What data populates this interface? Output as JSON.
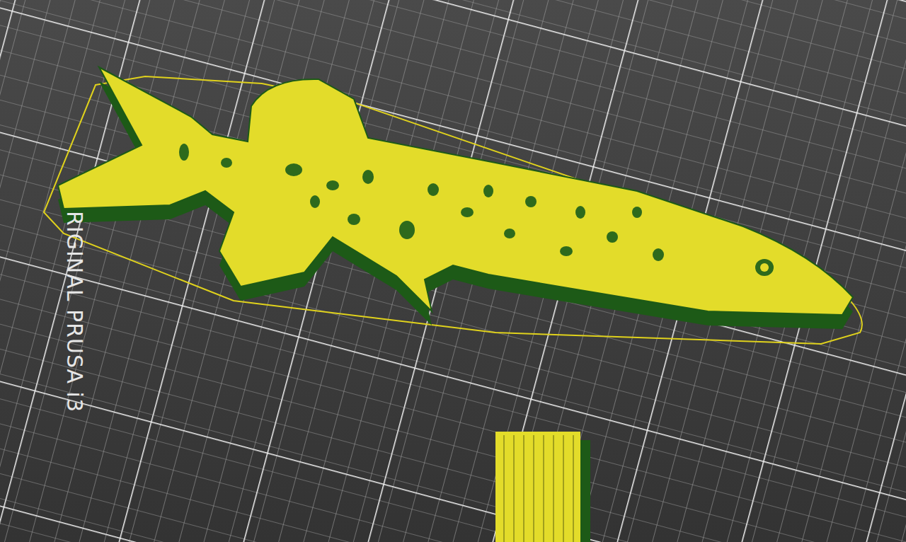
{
  "bed": {
    "label": "RIGINAL PRUSA i3"
  }
}
